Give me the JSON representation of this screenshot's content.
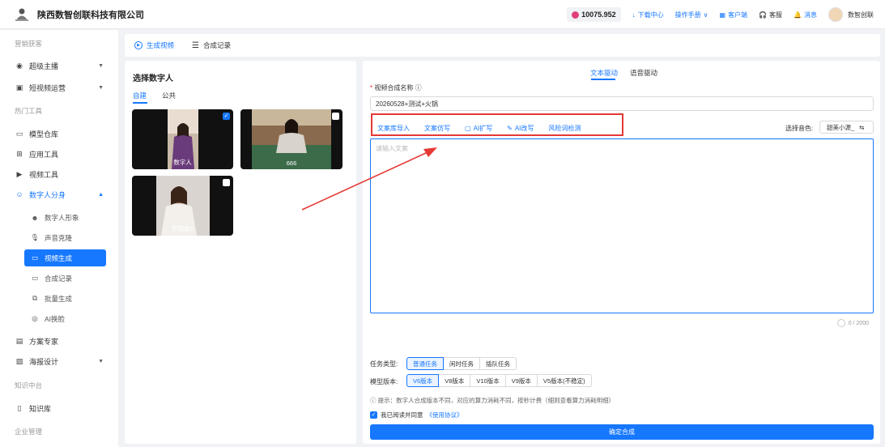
{
  "header": {
    "company": "陕西数智创联科技有限公司",
    "balance": "10075.952",
    "download_center": "下载中心",
    "manual": "操作手册",
    "client": "客户端",
    "service": "客服",
    "messages": "消息",
    "username": "数智创联"
  },
  "sidebar": {
    "section_marketing": "营销获客",
    "super_anchor": "超级主播",
    "short_video": "短视频运营",
    "section_hot": "热门工具",
    "model_warehouse": "模型仓库",
    "app_tools": "应用工具",
    "video_tools": "视频工具",
    "digital_clone": "数字人分身",
    "sub_items": [
      "数字人形象",
      "声音克隆",
      "视频生成",
      "合成记录",
      "批量生成",
      "AI换脸"
    ],
    "plan_expert": "方案专家",
    "poster_design": "海报设计",
    "section_knowledge": "知识中台",
    "knowledge_base": "知识库",
    "section_enterprise": "企业管理"
  },
  "tabs": {
    "generate": "生成视频",
    "records": "合成记录"
  },
  "left_panel": {
    "title": "选择数字人",
    "tab_custom": "自建",
    "tab_public": "公共",
    "avatars": [
      {
        "name": "数字人",
        "checked": true
      },
      {
        "name": "666",
        "checked": false
      },
      {
        "name": "罗晓蕾2",
        "checked": false
      }
    ]
  },
  "right_panel": {
    "tab_text": "文本驱动",
    "tab_voice": "语音驱动",
    "name_label": "视频合成名称",
    "name_value": "20260528+测试+火锅",
    "tools": [
      "文案库导入",
      "文案仿写",
      "AI扩写",
      "AI改写",
      "风险词检测"
    ],
    "voice_label": "选择音色:",
    "voice_value": "甜美小源_",
    "textarea_placeholder": "请输入文案",
    "counter": "0 / 2000",
    "task_type_label": "任务类型:",
    "task_types": [
      "普通任务",
      "闲时任务",
      "插队任务"
    ],
    "model_label": "模型版本:",
    "models": [
      "V6版本",
      "V8版本",
      "V10版本",
      "V9版本",
      "V5版本(不稳定)"
    ],
    "tip": "提示：数字人合成版本不同，对应的算力消耗不同，按秒计费（细则查看算力消耗明细）",
    "agree_text": "我已阅读并同意",
    "agreement_link": "《使用协议》",
    "submit": "确定合成"
  },
  "colors": {
    "accent": "#1677ff",
    "annotation": "#e53935"
  }
}
